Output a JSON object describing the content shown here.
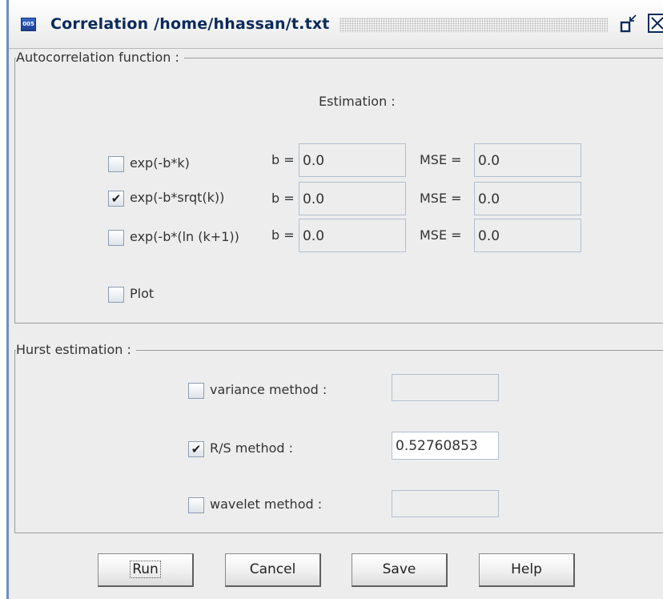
{
  "window": {
    "title": "Correlation /home/hhassan/t.txt",
    "app_icon_text": "005"
  },
  "autocorrelation": {
    "legend": "Autocorrelation function :",
    "estimation_label": "Estimation :",
    "rows": [
      {
        "label": "exp(-b*k)",
        "checked": false,
        "b_prefix": "b =",
        "b_value": "0.0",
        "mse_prefix": "MSE =",
        "mse_value": "0.0"
      },
      {
        "label": "exp(-b*srqt(k))",
        "checked": true,
        "b_prefix": "b =",
        "b_value": "0.0",
        "mse_prefix": "MSE =",
        "mse_value": "0.0"
      },
      {
        "label": "exp(-b*(ln (k+1))",
        "checked": false,
        "b_prefix": "b =",
        "b_value": "0.0",
        "mse_prefix": "MSE =",
        "mse_value": "0.0"
      }
    ],
    "plot_label": "Plot",
    "plot_checked": false
  },
  "hurst": {
    "legend": "Hurst estimation :",
    "methods": [
      {
        "label": "variance method :",
        "checked": false,
        "value": ""
      },
      {
        "label": "R/S method :",
        "checked": true,
        "value": "0.52760853"
      },
      {
        "label": "wavelet method :",
        "checked": false,
        "value": ""
      }
    ]
  },
  "buttons": {
    "run": "Run",
    "cancel": "Cancel",
    "save": "Save",
    "help": "Help"
  },
  "icons": {
    "check_mark": "✔"
  }
}
